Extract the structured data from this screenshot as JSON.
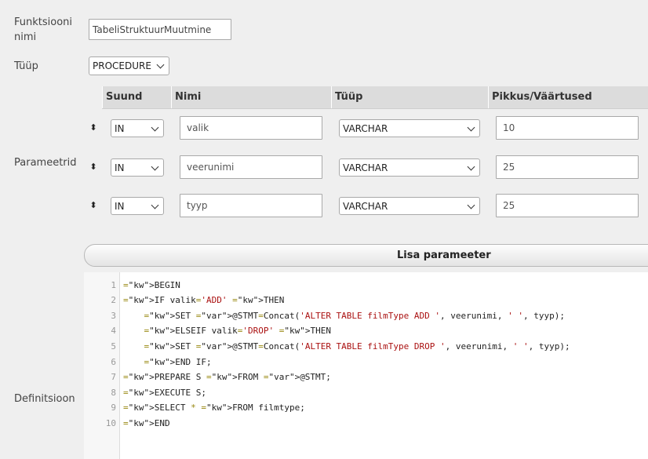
{
  "form": {
    "name_label": "Funktsiooni nimi",
    "name_value": "TabeliStruktuurMuutmine",
    "type_label": "Tüüp",
    "type_value": "PROCEDURE",
    "params_label": "Parameetrid",
    "definition_label": "Definitsioon"
  },
  "params_table": {
    "headers": [
      "Suund",
      "Nimi",
      "Tüüp",
      "Pikkus/Väärtused"
    ],
    "handle_glyph": "⬍",
    "rows": [
      {
        "direction": "IN",
        "name": "valik",
        "type": "VARCHAR",
        "length": "10"
      },
      {
        "direction": "IN",
        "name": "veerunimi",
        "type": "VARCHAR",
        "length": "25"
      },
      {
        "direction": "IN",
        "name": "tyyp",
        "type": "VARCHAR",
        "length": "25"
      }
    ]
  },
  "add_param_button": "Lisa parameeter",
  "editor": {
    "line_numbers": [
      "1",
      "2",
      "3",
      "4",
      "5",
      "6",
      "7",
      "8",
      "9",
      "10"
    ],
    "lines": [
      "BEGIN",
      "IF valik='ADD' THEN",
      "    SET @STMT=Concat('ALTER TABLE filmType ADD ', veerunimi, ' ', tyyp);",
      "    ELSEIF valik='DROP' THEN",
      "    SET @STMT=Concat('ALTER TABLE filmType DROP ', veerunimi, ' ', tyyp);",
      "    END IF;",
      "PREPARE S FROM @STMT;",
      "EXECUTE S;",
      "SELECT * FROM filmtype;",
      "END"
    ]
  },
  "colors": {
    "keyword": "#770088",
    "string": "#aa1111",
    "variable": "#0055aa",
    "background": "#efefef"
  }
}
